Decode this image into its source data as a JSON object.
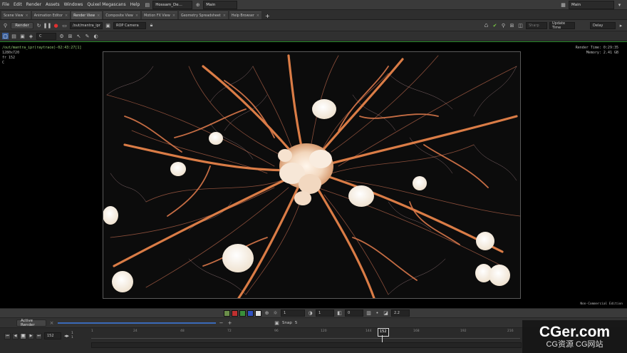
{
  "menubar": {
    "items": [
      "File",
      "Edit",
      "Render",
      "Assets",
      "Windows",
      "Quixel Megascans",
      "Help"
    ],
    "file_name": "Hossam_De...",
    "desktop": "Main",
    "right_desktop": "Main"
  },
  "tabs": [
    {
      "label": "Scene View"
    },
    {
      "label": "Animation Editor"
    },
    {
      "label": "Render View"
    },
    {
      "label": "Composite View"
    },
    {
      "label": "Motion FX View"
    },
    {
      "label": "Geometry Spreadsheet"
    },
    {
      "label": "Help Browser"
    }
  ],
  "toolbar": {
    "render_label": "Render",
    "rop_path": "/out/mantra_ipr",
    "camera": "ROP Camera",
    "snap_label": "Sharp",
    "update_time": "Update Time",
    "delay": "Delay",
    "channel": "C"
  },
  "viewport": {
    "render_path": "/out/mantra_ipr(raytrace)-02:43:27[1]",
    "resolution": "1280x720",
    "frame_info": "fr 152",
    "channel_info": "C",
    "render_time": "Render Time: 0:29:35",
    "memory": "Memory:      2.41 GB",
    "edition": "Non-Commercial Edition"
  },
  "bottom_controls": {
    "exposure": "1",
    "gamma_field": "1",
    "offset_field": "0",
    "gamma": "2.2"
  },
  "bottom_bar": {
    "active_render": "Active Render",
    "snap": "Snap",
    "snap_value": "5"
  },
  "timeline": {
    "current_frame": "152",
    "range_start": "1",
    "range_start2": "1",
    "ticks": [
      "1",
      "24",
      "48",
      "72",
      "96",
      "120",
      "144",
      "168",
      "192",
      "216",
      "240"
    ],
    "cursor_label": "152"
  },
  "watermark": {
    "line1": "CGer.com",
    "line2": "CG资源 CG网站"
  },
  "colors": {
    "accent_green": "#2c8c2c",
    "neuron": "#e6834a",
    "soma": "#f6e6d6"
  }
}
